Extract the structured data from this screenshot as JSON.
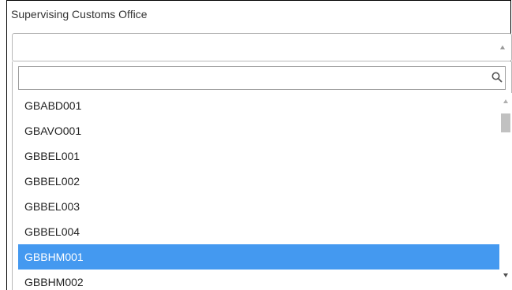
{
  "field": {
    "label": "Supervising Customs Office",
    "selected_value": ""
  },
  "dropdown": {
    "search": {
      "value": "",
      "placeholder": ""
    },
    "selected_index": 6,
    "options": [
      "GBABD001",
      "GBAVO001",
      "GBBEL001",
      "GBBEL002",
      "GBBEL003",
      "GBBEL004",
      "GBBHM001",
      "GBBHM002"
    ]
  },
  "icons": {
    "search": "search-icon",
    "select_arrow": "caret-up-icon",
    "scroll_up": "scroll-up-arrow-icon",
    "scroll_down": "scroll-down-arrow-icon"
  },
  "colors": {
    "highlight": "#4499f0",
    "highlight_text": "#ffffff",
    "text": "#222222"
  }
}
